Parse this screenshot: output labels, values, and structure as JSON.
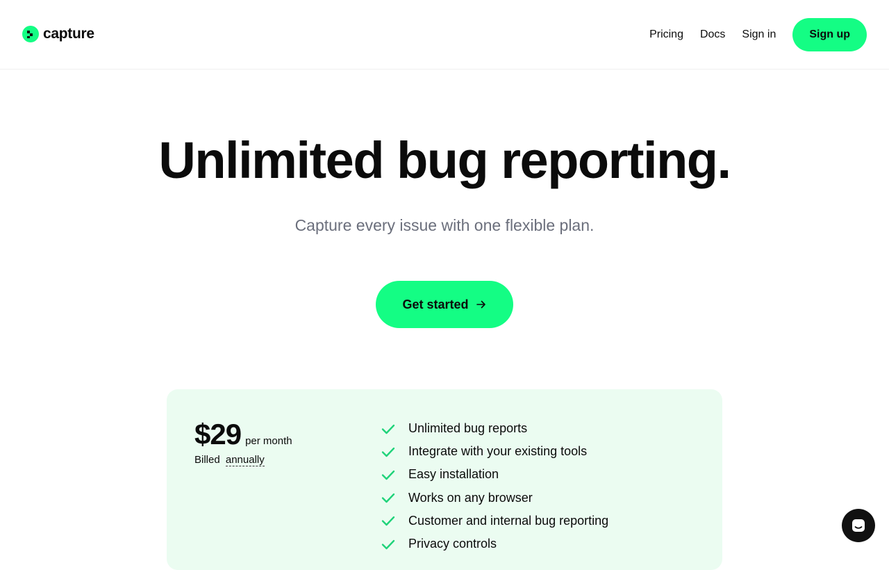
{
  "header": {
    "logo_text": "capture",
    "nav": {
      "pricing": "Pricing",
      "docs": "Docs",
      "sign_in": "Sign in",
      "sign_up": "Sign up"
    }
  },
  "hero": {
    "title": "Unlimited bug reporting.",
    "subtitle": "Capture every issue with one flexible plan.",
    "cta_label": "Get started"
  },
  "pricing": {
    "price": "$29",
    "period": "per month",
    "billed_prefix": "Billed",
    "billed_toggle": "annually",
    "features": [
      "Unlimited bug reports",
      "Integrate with your existing tools",
      "Easy installation",
      "Works on any browser",
      "Customer and internal bug reporting",
      "Privacy controls"
    ]
  },
  "colors": {
    "accent": "#14fd84",
    "card_bg": "#ebfcf1",
    "check": "#1fd37a",
    "subtitle_text": "#6b6f7c",
    "chat_bg": "#111111"
  },
  "icons": {
    "logo": "capture-logo-icon",
    "arrow": "arrow-right-icon",
    "check": "check-icon",
    "chat": "chat-icon"
  }
}
